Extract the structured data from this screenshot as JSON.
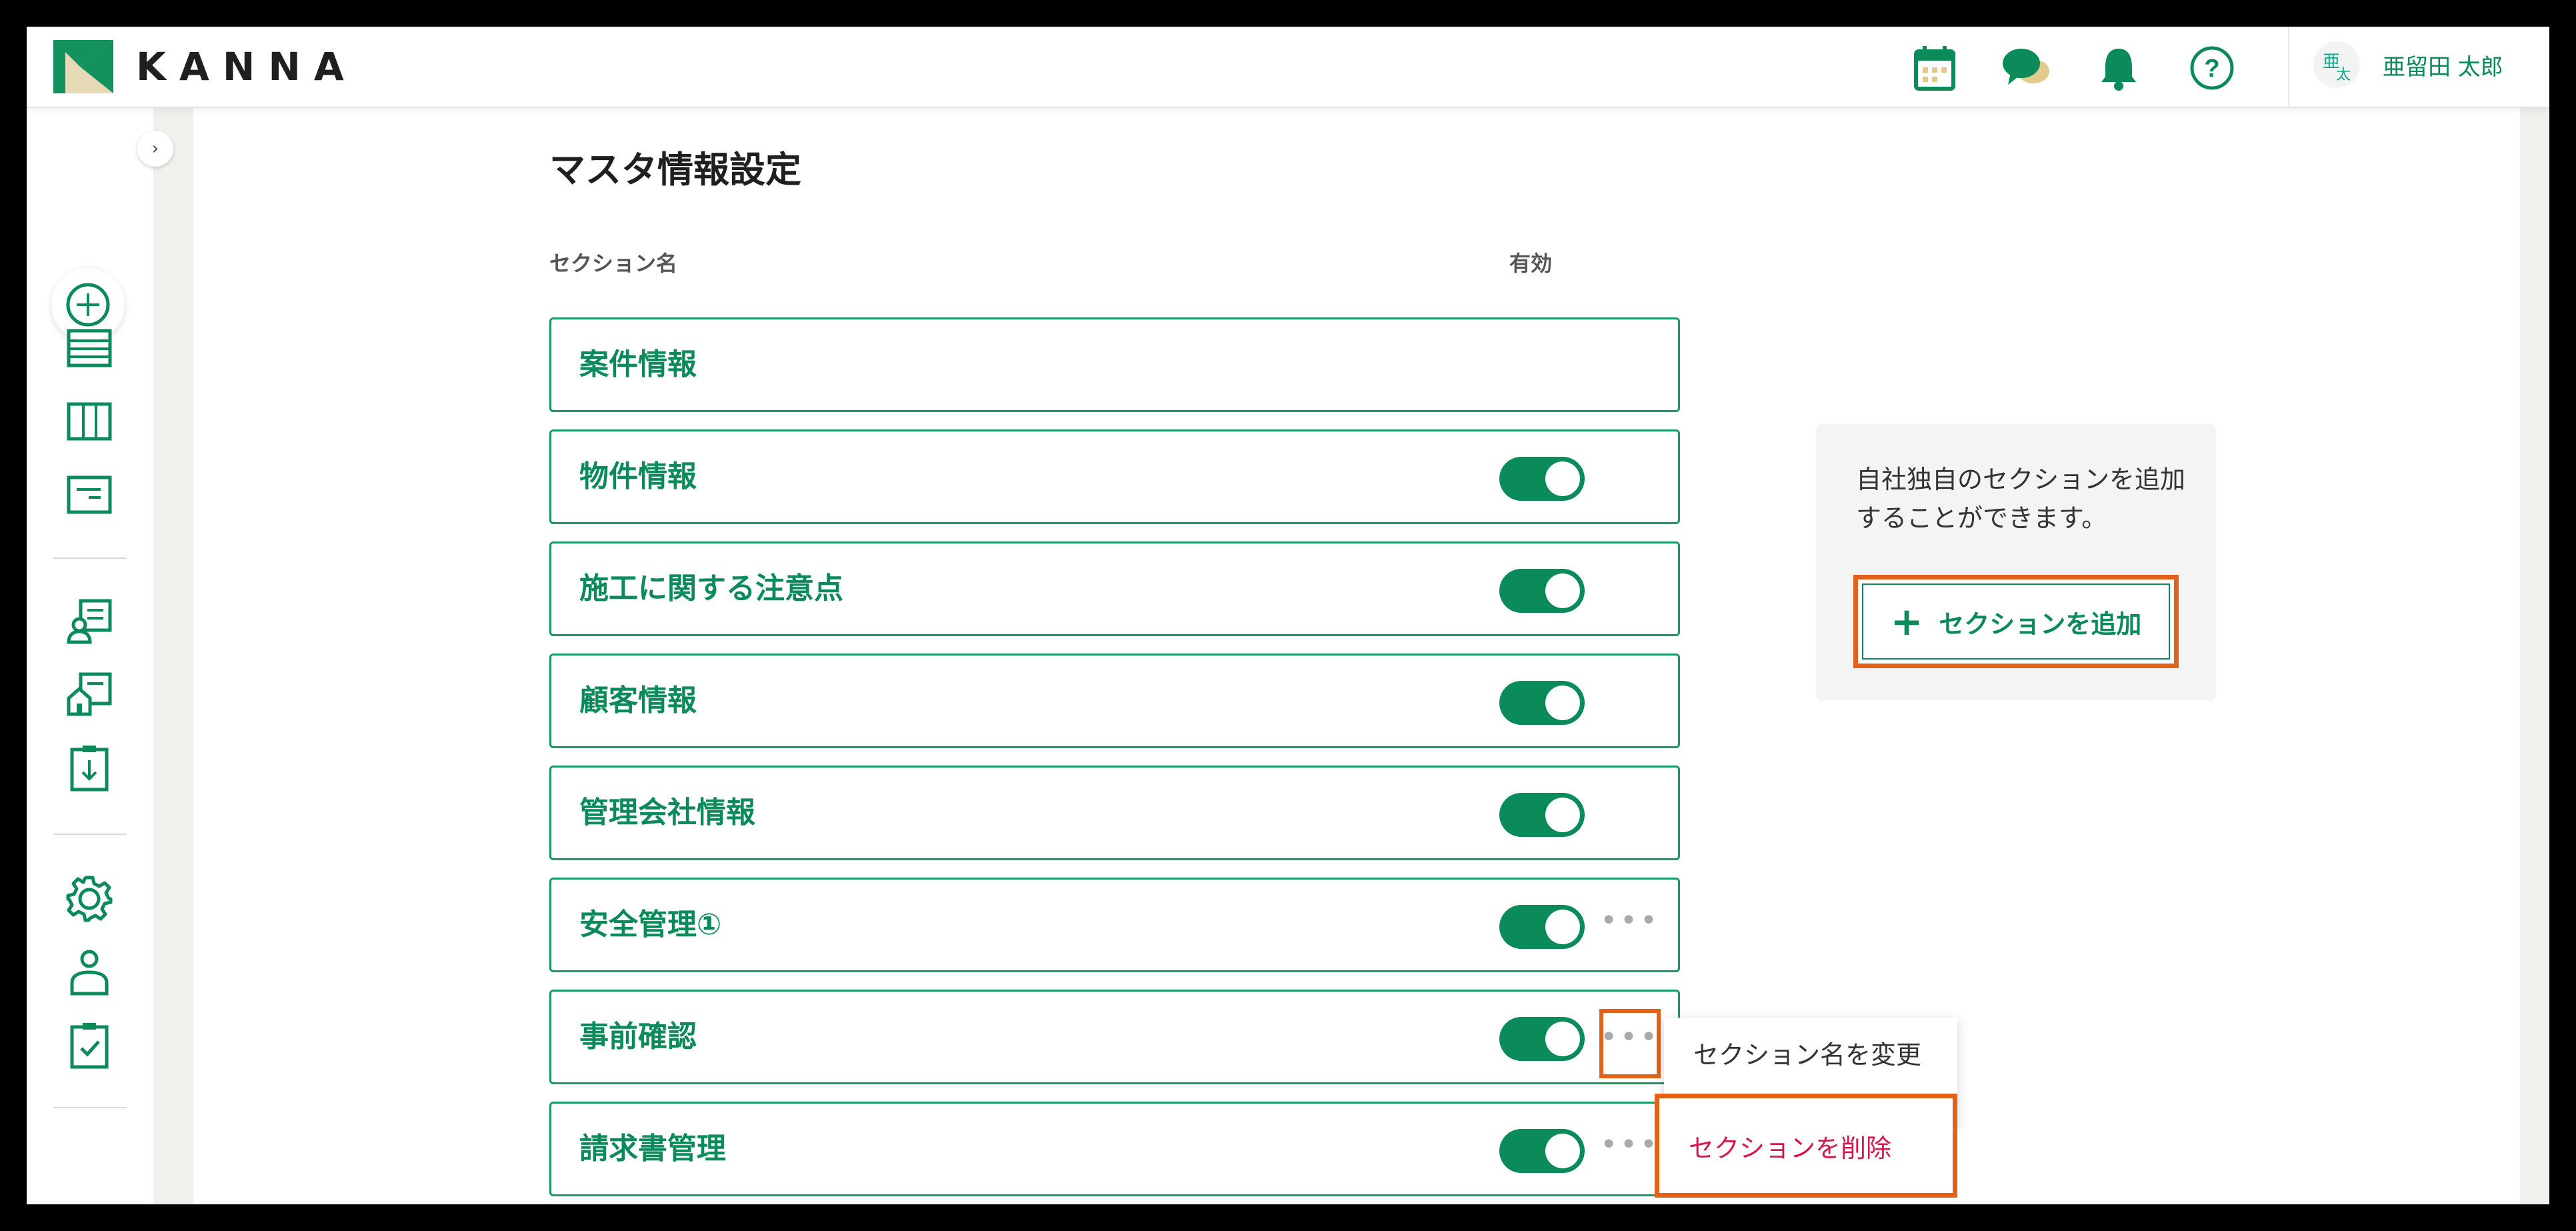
{
  "app": {
    "name": "KANNA"
  },
  "header": {
    "icons": [
      "calendar-icon",
      "chat-icon",
      "bell-icon",
      "help-icon"
    ],
    "user": {
      "avatar_top": "亜",
      "avatar_bottom": "太",
      "name": "亜留田 太郎"
    }
  },
  "sidebar": {
    "collapse_label": "›",
    "items": [
      "add-icon",
      "list-icon",
      "board-icon",
      "document-icon",
      "customer-icon",
      "property-icon",
      "download-icon",
      "settings-icon",
      "user-icon",
      "checklist-icon"
    ]
  },
  "page": {
    "title": "マスタ情報設定",
    "column_name": "セクション名",
    "column_enabled": "有効"
  },
  "sections": [
    {
      "name": "案件情報",
      "toggle": null,
      "more": false
    },
    {
      "name": "物件情報",
      "toggle": true,
      "more": false
    },
    {
      "name": "施工に関する注意点",
      "toggle": true,
      "more": false
    },
    {
      "name": "顧客情報",
      "toggle": true,
      "more": false
    },
    {
      "name": "管理会社情報",
      "toggle": true,
      "more": false
    },
    {
      "name": "安全管理①",
      "toggle": true,
      "more": true
    },
    {
      "name": "事前確認",
      "toggle": true,
      "more": true
    },
    {
      "name": "請求書管理",
      "toggle": true,
      "more": true
    }
  ],
  "panel": {
    "description": "自社独自のセクションを追加することができます。",
    "add_button": "セクションを追加"
  },
  "menu": {
    "rename": "セクション名を変更",
    "delete": "セクションを削除"
  },
  "colors": {
    "primary": "#0b8a5a",
    "highlight": "#e3621a",
    "danger": "#d6174f"
  }
}
